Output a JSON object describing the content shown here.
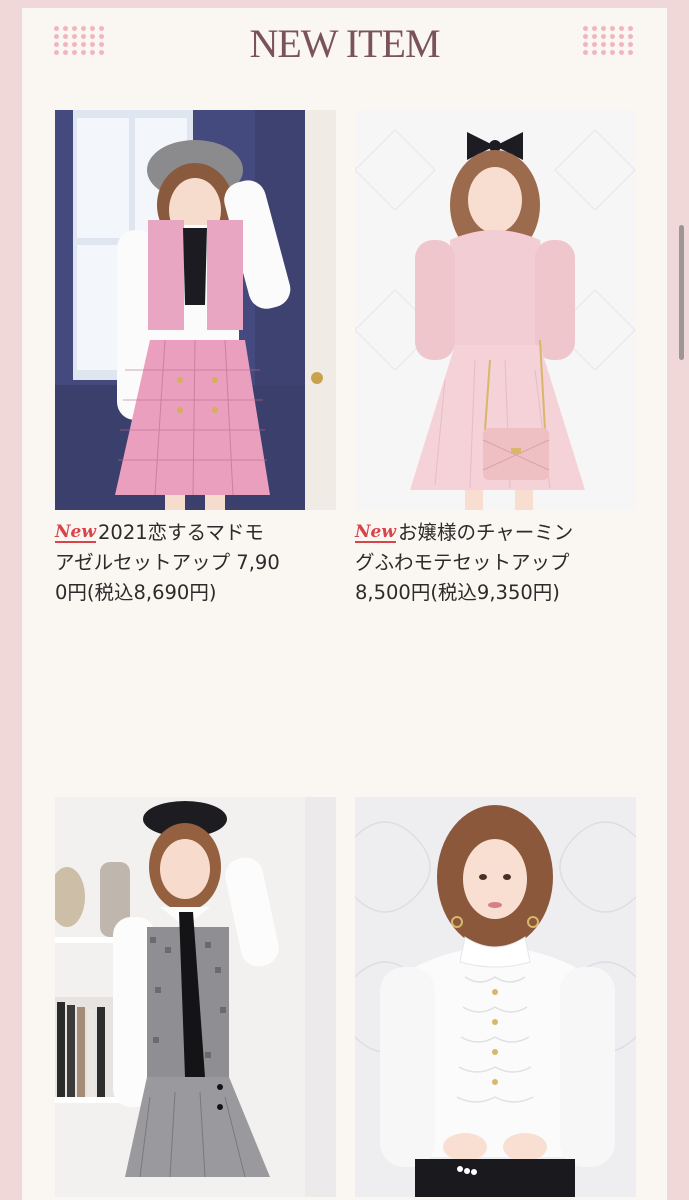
{
  "section": {
    "title": "NEW ITEM"
  },
  "products": [
    {
      "badge": "New",
      "name_line1": "2021恋するマドモ",
      "name_line2": "アゼルセットアップ 7,90",
      "price": "0円(税込8,690円)",
      "image": "model-pink-tweed-setup-image"
    },
    {
      "badge": "New",
      "name_line1": "お嬢様のチャーミン",
      "name_line2": "グふわモテセットアップ",
      "price": "8,500円(税込9,350円)",
      "image": "model-pink-fluffy-dress-image"
    },
    {
      "image": "model-houndstooth-dress-image"
    },
    {
      "image": "model-white-frill-blouse-image"
    }
  ],
  "colors": {
    "page_bg": "#faf6f1",
    "frame": "#f0d7d8",
    "title": "#7a5359",
    "new_badge": "#d9434a"
  }
}
